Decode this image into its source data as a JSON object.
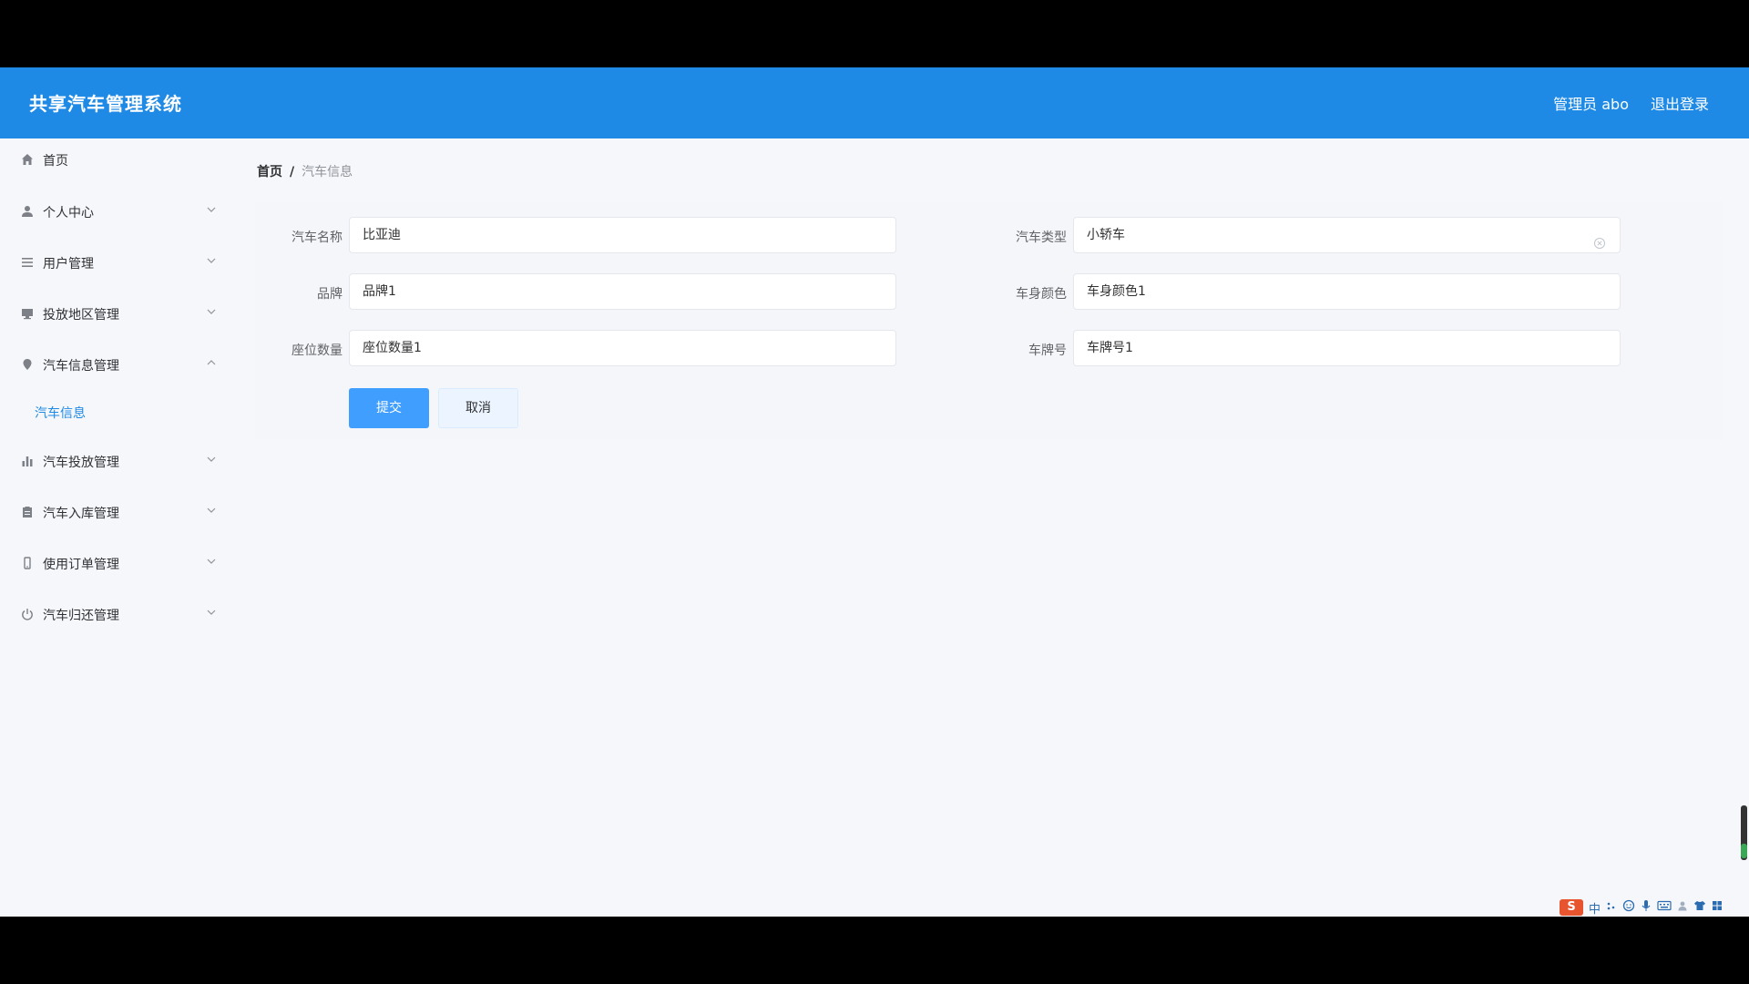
{
  "header": {
    "title": "共享汽车管理系统",
    "user": "管理员 abo",
    "logout": "退出登录"
  },
  "sidebar": {
    "items": [
      {
        "label": "首页",
        "icon": "home-icon"
      },
      {
        "label": "个人中心",
        "icon": "user-icon"
      },
      {
        "label": "用户管理",
        "icon": "list-icon"
      },
      {
        "label": "投放地区管理",
        "icon": "monitor-icon"
      },
      {
        "label": "汽车信息管理",
        "icon": "location-icon"
      },
      {
        "label": "汽车投放管理",
        "icon": "bar-chart-icon"
      },
      {
        "label": "汽车入库管理",
        "icon": "clipboard-icon"
      },
      {
        "label": "使用订单管理",
        "icon": "phone-icon"
      },
      {
        "label": "汽车归还管理",
        "icon": "power-icon"
      }
    ],
    "submenu": {
      "label": "汽车信息"
    }
  },
  "breadcrumb": {
    "home": "首页",
    "separator": "/",
    "current": "汽车信息"
  },
  "form": {
    "car_name": {
      "label": "汽车名称",
      "value": "比亚迪"
    },
    "car_type": {
      "label": "汽车类型",
      "value": "小轿车"
    },
    "brand": {
      "label": "品牌",
      "value": "品牌1"
    },
    "body_color": {
      "label": "车身颜色",
      "value": "车身颜色1"
    },
    "seat_count": {
      "label": "座位数量",
      "value": "座位数量1"
    },
    "plate_number": {
      "label": "车牌号",
      "value": "车牌号1"
    },
    "submit": "提交",
    "cancel": "取消"
  },
  "tray": {
    "logo": "S",
    "lang": "中"
  },
  "colors": {
    "header_bg": "#1f8ae5",
    "primary": "#409eff",
    "active_submenu": "#1f8ae5"
  }
}
